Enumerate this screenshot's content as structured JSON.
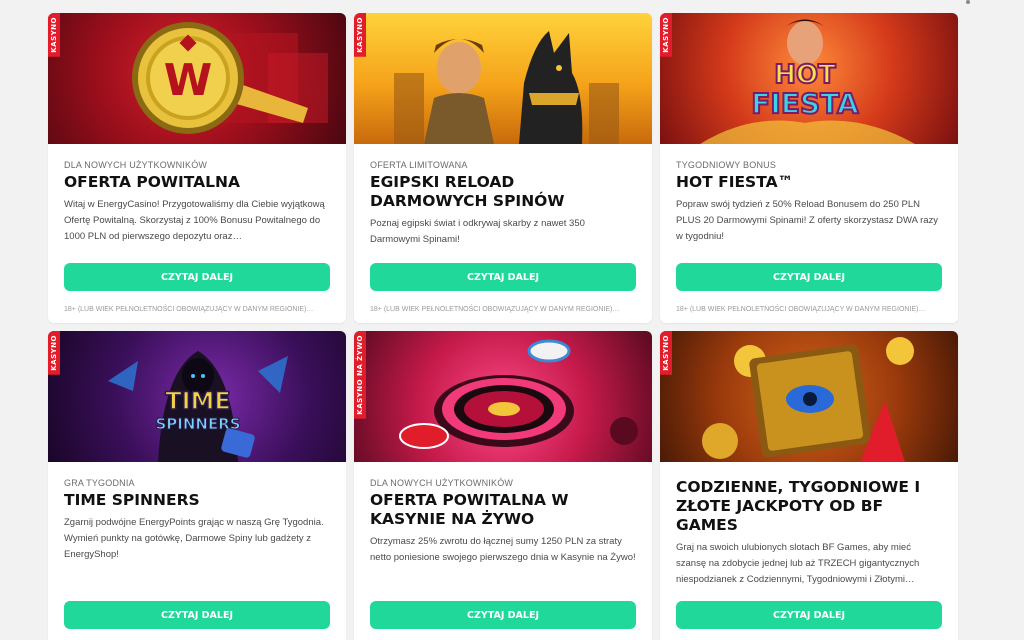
{
  "tag_default": "KASYNO",
  "cards": [
    {
      "tag": "KASYNO",
      "kicker": "DLA NOWYCH UŻYTKOWNIKÓW",
      "title": "OFERTA POWITALNA",
      "desc": "Witaj w EnergyCasino! Przygotowaliśmy dla Ciebie wyjątkową Ofertę Powitalną. Skorzystaj z 100% Bonusu Powitalnego do 1000 PLN od pierwszego depozytu oraz…",
      "button": "CZYTAJ DALEJ",
      "disclaimer": "18+ (LUB WIEK PEŁNOLETNOŚCI OBOWIĄZUJĄCY W DANYM REGIONIE)…"
    },
    {
      "tag": "KASYNO",
      "kicker": "OFERTA LIMITOWANA",
      "title": "EGIPSKI RELOAD DARMOWYCH SPINÓW",
      "desc": "Poznaj egipski świat i odkrywaj skarby z nawet 350 Darmowymi Spinami!",
      "button": "CZYTAJ DALEJ",
      "disclaimer": "18+ (LUB WIEK PEŁNOLETNOŚCI OBOWIĄZUJĄCY W DANYM REGIONIE)…"
    },
    {
      "tag": "KASYNO",
      "kicker": "TYGODNIOWY BONUS",
      "title": "HOT FIESTA™",
      "desc": "Popraw swój tydzień z 50% Reload Bonusem do 250 PLN PLUS 20 Darmowymi Spinami! Z oferty skorzystasz DWA razy w tygodniu!",
      "button": "CZYTAJ DALEJ",
      "disclaimer": "18+ (LUB WIEK PEŁNOLETNOŚCI OBOWIĄZUJĄCY W DANYM REGIONIE)…",
      "banner_text_1": "HOT",
      "banner_text_2": "FIESTA"
    },
    {
      "tag": "KASYNO",
      "kicker": "GRA TYGODNIA",
      "title": "TIME SPINNERS",
      "desc": "Zgarnij podwójne EnergyPoints grając w naszą Grę Tygodnia. Wymień punkty na gotówkę, Darmowe Spiny lub gadżety z EnergyShop!",
      "button": "CZYTAJ DALEJ",
      "banner_text_1": "TIME",
      "banner_text_2": "SPINNERS"
    },
    {
      "tag": "KASYNO NA ŻYWO",
      "kicker": "DLA NOWYCH UŻYTKOWNIKÓW",
      "title": "OFERTA POWITALNA W KASYNIE NA ŻYWO",
      "desc": "Otrzymasz 25% zwrotu do łącznej sumy 1250 PLN za straty netto poniesione swojego pierwszego dnia w Kasynie na Żywo!",
      "button": "CZYTAJ DALEJ"
    },
    {
      "tag": "KASYNO",
      "kicker": "",
      "title": "CODZIENNE, TYGODNIOWE I ZŁOTE JACKPOTY OD BF GAMES",
      "desc": "Graj na swoich ulubionych slotach BF Games, aby mieć szansę na zdobycie jednej lub aż TRZECH gigantycznych niespodzianek z Codziennymi, Tygodniowymi i Złotymi…",
      "button": "CZYTAJ DALEJ"
    }
  ],
  "colors": {
    "accent": "#1fd89a",
    "tag": "#e11d2b"
  }
}
